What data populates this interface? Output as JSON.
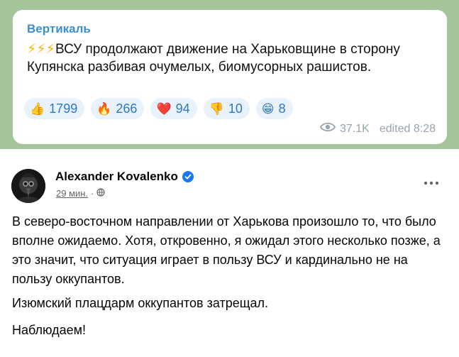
{
  "telegram": {
    "channel_name": "Вертикаль",
    "bolts": "⚡⚡⚡",
    "message": "ВСУ продолжают движение на Харьковщине в сторону Купянска разбивая очумелых, биомусорных рашистов.",
    "reactions": [
      {
        "emoji": "👍",
        "count": "1799",
        "icon": "thumbs-up-icon"
      },
      {
        "emoji": "🔥",
        "count": "266",
        "icon": "fire-icon"
      },
      {
        "emoji": "❤️",
        "count": "94",
        "icon": "heart-icon"
      },
      {
        "emoji": "👎",
        "count": "10",
        "icon": "thumbs-down-icon"
      },
      {
        "emoji": "😁",
        "count": "8",
        "icon": "grin-icon"
      }
    ],
    "views": "37.1K",
    "edited": "edited 8:28"
  },
  "facebook": {
    "author": "Alexander Kovalenko",
    "time": "29 мин.",
    "separator": "·",
    "paragraphs": [
      "В северо-восточном направлении от Харькова произошло то, что было вполне ожидаемо. Хотя, откровенно, я ожидал этого несколько позже, а это значит, что ситуация играет в пользу ВСУ и кардинально не на пользу оккупантов.",
      "Изюмский плацдарм оккупантов затрещал.",
      "Наблюдаем!"
    ]
  },
  "colors": {
    "telegram_background": "#a7c59b",
    "channel_name": "#3a8fd1",
    "reaction_bg": "#e9f2fb",
    "reaction_text": "#2b78c6",
    "facebook_verified": "#1877f2"
  }
}
